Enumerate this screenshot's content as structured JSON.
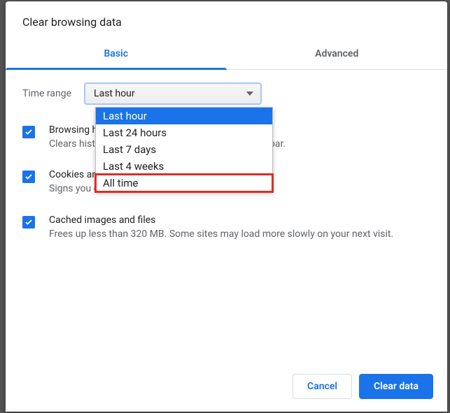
{
  "title": "Clear browsing data",
  "tabs": {
    "basic": "Basic",
    "advanced": "Advanced"
  },
  "time": {
    "label": "Time range",
    "selected": "Last hour",
    "options": {
      "o0": "Last hour",
      "o1": "Last 24 hours",
      "o2": "Last 7 days",
      "o3": "Last 4 weeks",
      "o4": "All time"
    }
  },
  "items": {
    "browsing": {
      "title": "Browsing history",
      "sub": "Clears history and autocompletions in the address bar."
    },
    "cookies": {
      "title": "Cookies and other site data",
      "sub": "Signs you out of most sites."
    },
    "cache": {
      "title": "Cached images and files",
      "sub": "Frees up less than 320 MB. Some sites may load more slowly on your next visit."
    }
  },
  "buttons": {
    "cancel": "Cancel",
    "clear": "Clear data"
  },
  "colors": {
    "accent": "#1a73e8",
    "highlight": "#d93025"
  }
}
